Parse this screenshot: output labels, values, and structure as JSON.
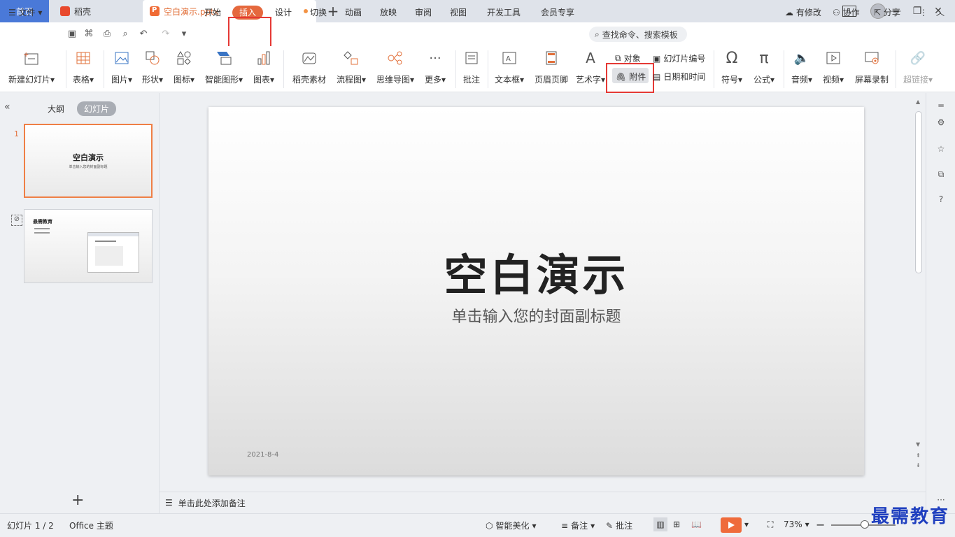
{
  "tabs": {
    "home": "首页",
    "shell": "稻壳",
    "active": "空白演示.pptx",
    "tab_count": "1"
  },
  "menu": {
    "file": "文件",
    "items": [
      "开始",
      "插入",
      "设计",
      "切换",
      "动画",
      "放映",
      "审阅",
      "视图",
      "开发工具",
      "会员专享"
    ],
    "active_item": "插入",
    "search_placeholder": "查找命令、搜索模板",
    "has_changes": "有修改",
    "collaborate": "协作",
    "share": "分享"
  },
  "ribbon": {
    "new_slide": "新建幻灯片",
    "table": "表格",
    "picture": "图片",
    "shape": "形状",
    "icon": "图标",
    "smart_art": "智能图形",
    "chart": "图表",
    "docer_material": "稻壳素材",
    "flowchart": "流程图",
    "mindmap": "思维导图",
    "more": "更多",
    "comment": "批注",
    "textbox": "文本框",
    "header_footer": "页眉页脚",
    "wordart": "艺术字",
    "object": "对象",
    "attachment": "附件",
    "slide_number": "幻灯片编号",
    "date_time": "日期和时间",
    "symbol": "符号",
    "formula": "公式",
    "audio": "音频",
    "video": "视频",
    "screen_record": "屏幕录制",
    "hyperlink": "超链接"
  },
  "left_pane": {
    "outline_tab": "大纲",
    "slides_tab": "幻灯片",
    "slide1_number": "1",
    "thumb1_title": "空白演示",
    "thumb1_sub": "单击输入您的封面副标题",
    "thumb2_title": "悬需教育"
  },
  "slide": {
    "title": "空白演示",
    "subtitle": "单击输入您的封面副标题",
    "date": "2021-8-4"
  },
  "notes_placeholder": "单击此处添加备注",
  "status": {
    "slide_count": "幻灯片 1 / 2",
    "theme": "Office 主题",
    "smart_beautify": "智能美化",
    "notes": "备注",
    "comments": "批注",
    "zoom": "73%"
  },
  "watermark": "最需教育",
  "colors": {
    "accent": "#e5683d",
    "home_tab": "#4a79d8",
    "highlight_box": "#e53935"
  }
}
